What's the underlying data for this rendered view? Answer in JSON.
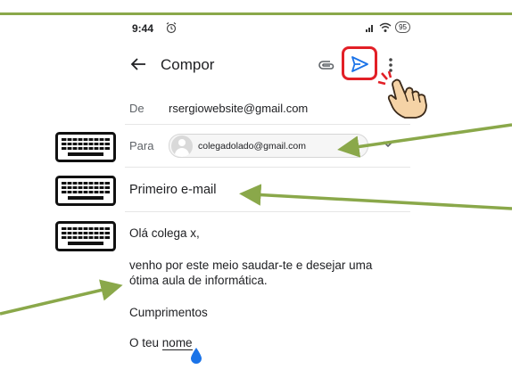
{
  "status_bar": {
    "time": "9:44",
    "battery": "95"
  },
  "appbar": {
    "title": "Compor"
  },
  "compose": {
    "from": {
      "label": "De",
      "value": "rsergiowebsite@gmail.com"
    },
    "to": {
      "label": "Para",
      "chip": "colegadolado@gmail.com"
    },
    "subject": {
      "value": "Primeiro e-mail"
    },
    "body": {
      "greeting": "Olá colega x,",
      "line1": "venho por este meio saudar-te e desejar uma",
      "line2": "ótima aula de informática.",
      "closing": "Cumprimentos",
      "sign_prefix": "O teu",
      "sign_name": "nome"
    }
  },
  "colors": {
    "send_highlight": "#e21f26",
    "send_icon": "#1a73e8",
    "arrow": "#8aa84a",
    "cursor": "#1a73e8"
  },
  "icons": [
    "alarm-icon",
    "signal-icon",
    "wifi-icon",
    "battery-icon",
    "back-arrow-icon",
    "attach-icon",
    "send-icon",
    "more-vert-icon",
    "hand-pointer-icon",
    "chevron-down-icon",
    "keyboard-icon",
    "text-cursor-handle-icon"
  ]
}
